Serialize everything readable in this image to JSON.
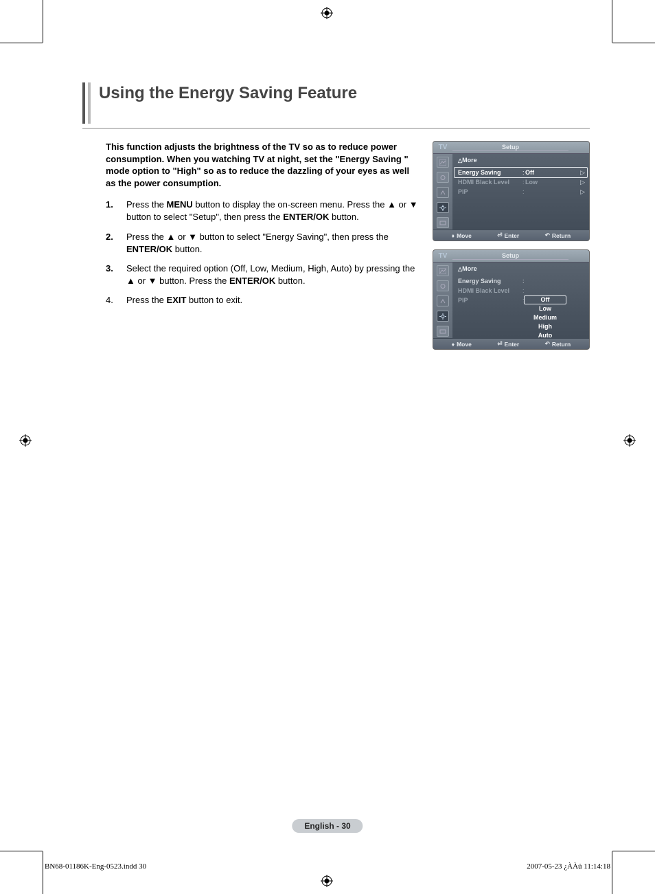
{
  "title": "Using the Energy Saving Feature",
  "intro": "This function adjusts the brightness of the TV so as to reduce power consumption. When you watching TV at night, set the \"Energy Saving \" mode option to \"High\" so as to reduce the dazzling of your eyes as well as the power consumption.",
  "steps": [
    {
      "num": "1.",
      "html": "Press the <b>MENU</b> button to display the on-screen menu. Press the ▲ or ▼ button to select \"Setup\", then press the <b>ENTER/OK</b> button."
    },
    {
      "num": "2.",
      "html": "Press the ▲ or ▼ button to select \"Energy Saving\", then press the <b>ENTER/OK</b> button."
    },
    {
      "num": "3.",
      "html": "Select the required option (Off, Low, Medium, High, Auto) by pressing the ▲ or ▼ button. Press the <b>ENTER/OK</b> button."
    },
    {
      "num": "4.",
      "plain": true,
      "html": "Press the <b>EXIT</b> button to exit."
    }
  ],
  "osd": {
    "tv": "TV",
    "title": "Setup",
    "more": "More",
    "rows1": [
      {
        "label": "Energy Saving",
        "val": "Off",
        "arrow": "▷",
        "sel": true
      },
      {
        "label": "HDMI Black Level",
        "val": "Low",
        "arrow": "▷",
        "dim": true
      },
      {
        "label": "PIP",
        "val": "",
        "arrow": "▷",
        "dim": true
      }
    ],
    "rows2": [
      {
        "label": "Energy Saving",
        "val": ""
      },
      {
        "label": "HDMI Black Level",
        "val": "",
        "dim": true
      },
      {
        "label": "PIP",
        "val": "",
        "dim": true
      }
    ],
    "options": [
      "Off",
      "Low",
      "Medium",
      "High",
      "Auto"
    ],
    "footer": {
      "move": "Move",
      "enter": "Enter",
      "return": "Return"
    }
  },
  "page_badge": "English - 30",
  "footer_left": "BN68-01186K-Eng-0523.indd   30",
  "footer_right": "2007-05-23   ¿ÀÀü 11:14:18"
}
